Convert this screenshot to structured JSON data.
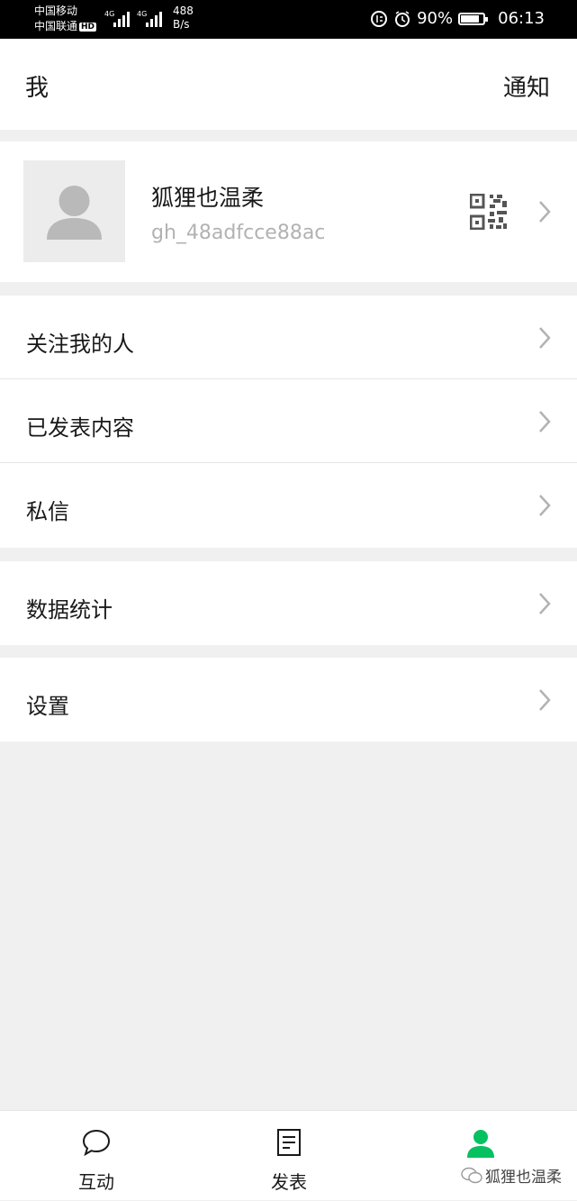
{
  "status_bar": {
    "carrier1": "中国移动",
    "carrier2": "中国联通",
    "hd": "HD",
    "net1": "4G",
    "net2": "4G",
    "speed_value": "488",
    "speed_unit": "B/s",
    "battery": "90%",
    "battery_level": 0.9,
    "time": "06:13"
  },
  "header": {
    "title": "我",
    "notify": "通知"
  },
  "profile": {
    "name": "狐狸也温柔",
    "account_id": "gh_48adfcce88ac"
  },
  "menu": {
    "followers": "关注我的人",
    "published": "已发表内容",
    "messages": "私信",
    "stats": "数据统计",
    "settings": "设置"
  },
  "tabbar": {
    "interact": "互动",
    "publish": "发表"
  },
  "watermark": "狐狸也温柔",
  "colors": {
    "accent": "#07c160",
    "background": "#f0f0f0"
  }
}
